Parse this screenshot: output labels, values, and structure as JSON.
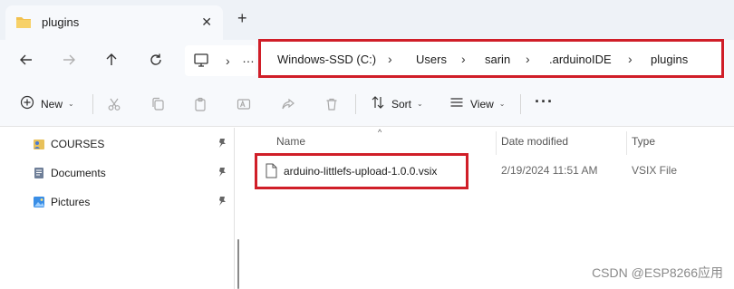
{
  "tab": {
    "title": "plugins",
    "close_glyph": "✕",
    "new_tab_glyph": "+"
  },
  "nav": {
    "back": "back-arrow-icon",
    "forward": "forward-arrow-icon",
    "up": "up-arrow-icon",
    "refresh": "refresh-icon",
    "pc_chevron": "›",
    "pc_more": "…"
  },
  "address": {
    "crumbs": [
      "Windows-SSD (C:)",
      "Users",
      "sarin",
      ".arduinoIDE",
      "plugins"
    ],
    "separator": "›",
    "highlight_color": "#d01e28"
  },
  "commands": {
    "new_label": "New",
    "sort_label": "Sort",
    "view_label": "View",
    "more_label": "···",
    "drop_glyph": "⌄"
  },
  "sidebar": {
    "items": [
      {
        "label": "COURSES",
        "icon": "courses-folder-icon"
      },
      {
        "label": "Documents",
        "icon": "documents-icon"
      },
      {
        "label": "Pictures",
        "icon": "pictures-icon"
      }
    ]
  },
  "filelist": {
    "sort_caret": "^",
    "columns": {
      "name": "Name",
      "date": "Date modified",
      "type": "Type"
    },
    "rows": [
      {
        "name": "arduino-littlefs-upload-1.0.0.vsix",
        "date": "2/19/2024 11:51 AM",
        "type": "VSIX File"
      }
    ]
  },
  "watermark": "CSDN @ESP8266应用"
}
